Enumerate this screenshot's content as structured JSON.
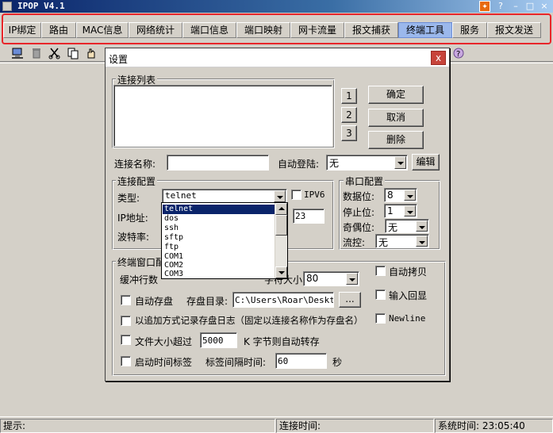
{
  "window": {
    "title": "IPOP V4.1",
    "title_buttons": [
      "?",
      "–",
      "□",
      "×"
    ]
  },
  "tabs": [
    {
      "label": "IP绑定",
      "active": false
    },
    {
      "label": "路由",
      "active": false
    },
    {
      "label": "MAC信息",
      "active": false
    },
    {
      "label": "网络统计",
      "active": false
    },
    {
      "label": "端口信息",
      "active": false
    },
    {
      "label": "端口映射",
      "active": false
    },
    {
      "label": "网卡流量",
      "active": false
    },
    {
      "label": "报文捕获",
      "active": false
    },
    {
      "label": "终端工具",
      "active": true
    },
    {
      "label": "服务",
      "active": false
    },
    {
      "label": "报文发送",
      "active": false
    }
  ],
  "colors": {
    "tab_highlight_border": "#e8262a",
    "active_tab": "#9bb8ec",
    "selection": "#0a246a",
    "close_button": "#c7443b"
  },
  "dialog": {
    "title": "设置",
    "close": "x",
    "connection_list": {
      "label": "连接列表",
      "num_buttons": [
        "1",
        "2",
        "3"
      ],
      "ok": "确定",
      "cancel": "取消",
      "delete": "删除"
    },
    "conn_name_label": "连接名称:",
    "conn_name_value": "",
    "auto_login_label": "自动登陆:",
    "auto_login_value": "无",
    "edit_button": "编辑",
    "conn_config": {
      "label": "连接配置",
      "type_label": "类型:",
      "type_value": "telnet",
      "ipv6_label": "IPV6",
      "ip_label": "IP地址:",
      "port_value": "23",
      "baud_label": "波特率:",
      "type_options": [
        "telnet",
        "dos",
        "ssh",
        "sftp",
        "ftp",
        "COM1",
        "COM2",
        "COM3"
      ],
      "selected_option": "telnet"
    },
    "serial_config": {
      "label": "串口配置",
      "data_bits_label": "数据位:",
      "data_bits_value": "8",
      "stop_bits_label": "停止位:",
      "stop_bits_value": "1",
      "parity_label": "奇偶位:",
      "parity_value": "无",
      "flow_label": "流控:",
      "flow_value": "无"
    },
    "terminal_config": {
      "label": "终端窗口配置",
      "buffer_label": "缓冲行数",
      "buffer_value": "",
      "font_label": "字符大小:",
      "font_value": "80",
      "auto_copy": "自动拷贝",
      "auto_save": "自动存盘",
      "save_dir_label": "存盘目录:",
      "save_dir_value": "C:\\Users\\Roar\\Desktop",
      "browse_button": "...",
      "input_echo": "输入回显",
      "append_log": "以追加方式记录存盘日志（固定以连接名称作为存盘名）",
      "newline": "Newline",
      "size_exceed_label": "文件大小超过",
      "size_exceed_value": "5000",
      "size_exceed_suffix": "K 字节则自动转存",
      "timestamp_label": "启动时间标签",
      "interval_label": "标签间隔时间:",
      "interval_value": "60",
      "interval_unit": "秒"
    }
  },
  "statusbar": {
    "hint_label": "提示:",
    "conn_time_label": "连接时间:",
    "sys_time_label": "系统时间: 23:05:40"
  }
}
